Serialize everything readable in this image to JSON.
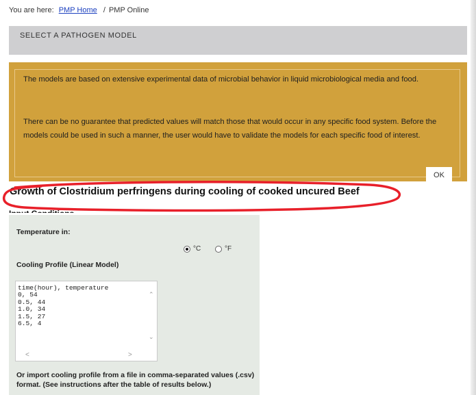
{
  "breadcrumb": {
    "prefix": "You are here:",
    "home_link": "PMP Home",
    "separator": "/",
    "current": "PMP Online"
  },
  "model_selector": {
    "label": "SELECT A PATHOGEN MODEL"
  },
  "disclaimer": {
    "paragraph1": "The models are based on extensive experimental data of microbial behavior in liquid microbiological media and food.",
    "paragraph2": "There can be no guarantee that predicted values will match those that would occur in any specific food system. Before the models could be used in such a manner, the user would have to validate the models for each specific food of interest.",
    "ok_label": "OK"
  },
  "page_title": "Growth of Clostridium perfringens during cooling of cooked uncured Beef",
  "input_conditions": {
    "heading": "Input Conditions",
    "temperature_label": "Temperature in:",
    "unit_celsius": "°C",
    "unit_fahrenheit": "°F",
    "selected_unit": "°C",
    "cooling_profile_label": "Cooling Profile (Linear Model)",
    "cooling_profile_value": "time(hour), temperature\n0, 54\n0.5, 44\n1.0, 34\n1.5, 27\n6.5, 4",
    "import_note": "Or import cooling profile from a file in comma-separated values (.csv) format. (See instructions after the table of results below.)"
  },
  "colors": {
    "link": "#1a3fbf",
    "model_bar_bg": "#cfcfd1",
    "disclaimer_bg": "#d1a13c",
    "input_panel_bg": "#e5eae4",
    "annotation_red": "#e8202a"
  },
  "icons": {
    "scroll_up": "chevron-up-icon",
    "scroll_down": "chevron-down-icon",
    "scroll_left": "chevron-left-icon",
    "scroll_right": "chevron-right-icon"
  }
}
